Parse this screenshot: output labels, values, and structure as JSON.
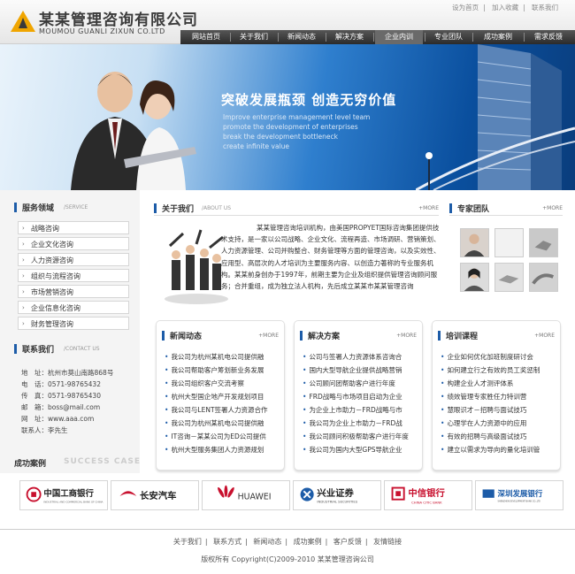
{
  "header": {
    "logo_cn": "某某管理咨询有限公司",
    "logo_en": "MOUMOU GUANLI ZIXUN CO.LTD",
    "links": [
      "设为首页",
      "加入收藏",
      "联系我们"
    ],
    "nav": [
      "网站首页",
      "关于我们",
      "新闻动态",
      "解决方案",
      "企业内训",
      "专业团队",
      "成功案例",
      "需求反馈"
    ]
  },
  "banner": {
    "title": "突破发展瓶颈 创造无穷价值",
    "lines": [
      "Improve enterprise management level team",
      "promote the development of enterprises",
      "break the development bottleneck",
      "create infinite value"
    ]
  },
  "services": {
    "title": "服务领域",
    "title_en": "/SERVICE",
    "items": [
      "战略咨询",
      "企业文化咨询",
      "人力资源咨询",
      "组织与流程咨询",
      "市场营销咨询",
      "企业信息化咨询",
      "财务管理咨询"
    ]
  },
  "contact": {
    "title": "联系我们",
    "title_en": "/CONTACT US",
    "rows": [
      "地　址：杭州市莫山南路868号",
      "电　话：0571-98765432",
      "传　真：0571-98765430",
      "邮　箱：boss@mail.com",
      "网　址：www.aaa.com",
      "联系人：李先生"
    ]
  },
  "about": {
    "title": "关于我们",
    "title_en": "/ABOUT US",
    "more": "+MORE",
    "text": "某某管理咨询培训机构，由美国PROPYET国际咨询集团提供技术支持，是一家以公司战略、企业文化、流程再造、市场调研、营销策划、人力资源管理、公司并购整合、财务管理等方面的管理咨询，以及实效性、应用型、高层次的人才培训为主要服务内容、以创造力著称的专业服务机构。某某前身创办于1997年，前期主要为企业及组织提供管理咨询顾问服务；合并重组，成为独立法人机构，先后成立某某市某某管理咨询"
  },
  "team": {
    "title": "专家团队",
    "more": "+MORE"
  },
  "news": {
    "title": "新闻动态",
    "more": "+MORE",
    "items": [
      "我公司为杭州某机电公司提供融",
      "我公司帮助客户筹划新业务发展",
      "我公司组织客户交流考察",
      "杭州大型国企地产开发规划项目",
      "我公司与LENT签署人力资源合作",
      "我公司为杭州某机电公司提供融",
      "IT咨询－某某公司为ED公司提供",
      "杭州大型服务集团人力资源规划"
    ]
  },
  "solutions": {
    "title": "解决方案",
    "more": "+MORE",
    "items": [
      "公司与签署人力资源体系咨询合",
      "国内大型导航企业提供战略营销",
      "公司顾问团帮助客户进行年度",
      "FRD战略与市场项目启动为企业",
      "为企业上市助力－FRD战略与市",
      "我公司为企业上市助力－FRD战",
      "我公司顾问积极帮助客户进行年度",
      "我公司为国内大型GPS导航企业"
    ]
  },
  "training": {
    "title": "培训课程",
    "more": "+MORE",
    "items": [
      "企业如何优化加班制度研讨会",
      "如何建立行之有效的员工奖惩制",
      "构建企业人才测评体系",
      "绩效管理专家胜任力特训营",
      "慧眼识才－招聘与面试技巧",
      "心理学在人力资源中的应用",
      "有效的招聘与高级面试技巧",
      "建立以需求为导向的量化培训管"
    ]
  },
  "cases": {
    "title": "成功案例",
    "title_en": "SUCCESS CASE",
    "logos": [
      {
        "cn": "中国工商银行",
        "en": "INDUSTRIAL AND COMMERCIAL BANK OF CHINA"
      },
      {
        "cn": "长安汽车"
      },
      {
        "cn": "HUAWEI"
      },
      {
        "cn": "兴业证券",
        "en": "INDUSTRIAL SECURITIES"
      },
      {
        "cn": "中信银行",
        "en": "CHINA CITIC BANK"
      },
      {
        "cn": "深圳发展银行",
        "en": "SHENZHEN DEVELOPMENT BANK CO.,LTD"
      }
    ]
  },
  "footer": {
    "links": [
      "关于我们",
      "联系方式",
      "新闻动态",
      "成功案例",
      "客户反馈",
      "友情链接"
    ],
    "copyright": "版权所有 Copyright(C)2009-2010 某某管理咨询公司"
  },
  "colors": {
    "accent": "#1d5ca8",
    "nav_bg": "#3a3a3a",
    "logo_orange": "#f0a500",
    "icbc_red": "#c8102e",
    "citic_red": "#c8102e"
  }
}
